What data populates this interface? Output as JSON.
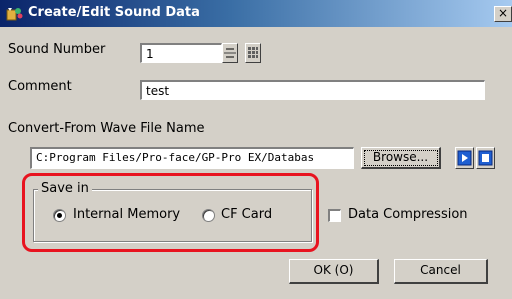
{
  "window": {
    "title": "Create/Edit Sound Data",
    "close_glyph": "×"
  },
  "form": {
    "sound_number_label": "Sound Number",
    "sound_number_value": "1",
    "comment_label": "Comment",
    "comment_value": "test",
    "wave_label": "Convert-From Wave File Name",
    "wave_path_value": "C:Program Files/Pro-face/GP-Pro EX/Databas",
    "browse_label": "Browse..."
  },
  "save_in": {
    "group_label": "Save in",
    "options": [
      {
        "label": "Internal Memory",
        "selected": true
      },
      {
        "label": "CF Card",
        "selected": false
      }
    ]
  },
  "data_compression": {
    "label": "Data Compression",
    "checked": false
  },
  "buttons": {
    "ok_label": "OK (O)",
    "cancel_label": "Cancel"
  },
  "icons": {
    "title": "sound-data-app-icon",
    "play": "play-icon",
    "stop": "stop-icon",
    "spin": "spin-up-down-icon",
    "keypad": "keypad-icon"
  },
  "colors": {
    "title_bar_start": "#0a246a",
    "title_bar_end": "#a6caf0",
    "dialog_bg": "#d4d0c8",
    "highlight_border": "#e8131f",
    "media_icon": "#1f5fd1"
  }
}
